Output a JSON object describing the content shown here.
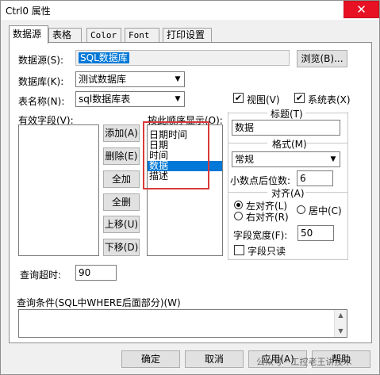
{
  "window": {
    "title": "Ctrl0 属性",
    "close_glyph": "✕"
  },
  "tabs": [
    {
      "label": "数据源",
      "active": true
    },
    {
      "label": "表格"
    },
    {
      "label": "Color"
    },
    {
      "label": "Font"
    },
    {
      "label": "打印设置"
    }
  ],
  "datasource": {
    "label": "数据源(S):",
    "value": "SQL数据库",
    "browse_label": "浏览(B)..."
  },
  "database": {
    "label": "数据库(K):",
    "value": "测试数据库"
  },
  "table": {
    "label": "表名称(N):",
    "value": "sql数据库表"
  },
  "checks": {
    "view": {
      "label": "视图(V)",
      "checked": "✔"
    },
    "system": {
      "label": "系统表(X)",
      "checked": "✔"
    }
  },
  "fields": {
    "valid_label": "有效字段(V):",
    "order_label": "按此顺序显示(O):",
    "order_items": [
      "日期时间",
      "日期",
      "时间",
      "数据",
      "描述"
    ],
    "selected_index": 3
  },
  "buttons": {
    "add": "添加(A)",
    "delete": "删除(E)",
    "add_all": "全加",
    "delete_all": "全删",
    "move_up": "上移(U)",
    "move_down": "下移(D)"
  },
  "right_panel": {
    "caption_label": "标题(T)",
    "caption_value": "数据",
    "format_label": "格式(M)",
    "format_value": "常规",
    "decimals_label": "小数点后位数:",
    "decimals_value": "6",
    "align_label": "对齐(A)",
    "align_left": "左对齐(L)",
    "align_right": "右对齐(R)",
    "align_center": "居中(C)",
    "width_label": "字段宽度(F):",
    "width_value": "50",
    "readonly_label": "字段只读"
  },
  "timeout": {
    "label": "查询超时:",
    "value": "90"
  },
  "where": {
    "label": "查询条件(SQL中WHERE后面部分)(W)"
  },
  "footer": {
    "ok": "确定",
    "cancel": "取消",
    "apply": "应用(A)",
    "help": "帮助"
  },
  "watermark": {
    "text": "公众号 · 工控老王讲技术"
  }
}
